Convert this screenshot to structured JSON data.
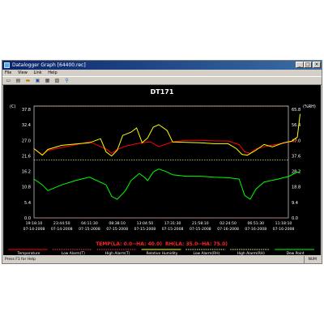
{
  "window": {
    "title": "Datalogger Graph [64400.rec]",
    "min": "_",
    "max": "□",
    "close": "×"
  },
  "menu": [
    "File",
    "View",
    "Link",
    "Help"
  ],
  "toolbar_icons": [
    "new-icon",
    "open-icon",
    "save-icon",
    "print-icon",
    "zoom-icon"
  ],
  "graph": {
    "title": "DT171",
    "left_unit": "(C)",
    "right_unit": "(%RH)",
    "left_ticks": [
      "37.8",
      "32.4",
      "27.0",
      "21.6",
      "16.2",
      "10.8",
      "5.4",
      "0.0"
    ],
    "right_ticks": [
      "65.8",
      "56.4",
      "47.0",
      "37.6",
      "28.2",
      "18.8",
      "9.4",
      "0.0"
    ],
    "x_times": [
      "19:18:10",
      "23:44:50",
      "04:11:30",
      "08:38:10",
      "13:04:50",
      "17:31:30",
      "21:58:10",
      "02:24:50",
      "06:51:30",
      "11:18:10"
    ],
    "x_dates": [
      "07-14-2008",
      "07-14-2008",
      "07-15-2008",
      "07-15-2008",
      "07-15-2008",
      "07-15-2008",
      "07-15-2008",
      "07-16-2008",
      "07-16-2008",
      "07-16-2008"
    ],
    "alarm_text_temp": "TEMP(LA: 0.0--HA: 40.0)",
    "alarm_text_rh": "RH(LA: 35.0--HA: 75.0)",
    "legend": [
      {
        "label": "Temperature",
        "color": "#ff0000",
        "dashed": false
      },
      {
        "label": "Low Alarm(T)",
        "color": "#ff4040",
        "dashed": true
      },
      {
        "label": "High Alarm(T)",
        "color": "#ff4040",
        "dashed": true
      },
      {
        "label": "Relative Humidity",
        "color": "#ffff00",
        "dashed": false
      },
      {
        "label": "Low Alarm(RH)",
        "color": "#ffff80",
        "dashed": true
      },
      {
        "label": "High Alarm(RH)",
        "color": "#ffff80",
        "dashed": true
      },
      {
        "label": "Dew Point",
        "color": "#00ff00",
        "dashed": false
      }
    ]
  },
  "status": {
    "left": "Press F1 for Help",
    "right": "NUM"
  },
  "chart_data": {
    "type": "line",
    "title": "DT171",
    "ylabel": "(C)",
    "y2label": "(%RH)",
    "ylim": [
      0,
      37.8
    ],
    "y2lim": [
      0,
      65.8
    ],
    "categories": [
      "19:18:10",
      "23:44:50",
      "04:11:30",
      "08:38:10",
      "13:04:50",
      "17:31:30",
      "21:58:10",
      "02:24:50",
      "06:51:30",
      "11:18:10"
    ],
    "series": [
      {
        "name": "Temperature",
        "axis": "left",
        "color": "#ff0000",
        "x": [
          0,
          0.3,
          0.5,
          1.0,
          2.0,
          2.6,
          2.8,
          3.0,
          3.3,
          3.8,
          4.2,
          4.5,
          5.0,
          5.5,
          6.0,
          6.6,
          7.0,
          7.4,
          7.6,
          7.8,
          8.0,
          8.5,
          9.0,
          9.5
        ],
        "values": [
          24.0,
          22.0,
          23.5,
          24.5,
          26.5,
          24.0,
          22.5,
          23.8,
          25.0,
          26.0,
          26.5,
          24.8,
          26.5,
          27.0,
          27.0,
          26.8,
          26.8,
          25.5,
          23.0,
          22.5,
          24.0,
          25.2,
          26.0,
          27.0
        ]
      },
      {
        "name": "Relative Humidity",
        "axis": "right",
        "color": "#ffff00",
        "x": [
          0,
          0.3,
          0.5,
          1.0,
          2.0,
          2.4,
          2.6,
          2.8,
          3.0,
          3.2,
          3.5,
          3.7,
          3.9,
          4.1,
          4.3,
          4.5,
          4.8,
          5.0,
          5.5,
          6.0,
          6.5,
          7.0,
          7.3,
          7.5,
          7.7,
          8.0,
          8.3,
          8.6,
          9.0,
          9.3,
          9.5,
          9.6
        ],
        "values": [
          42.0,
          38.0,
          41.5,
          44.0,
          45.5,
          48.0,
          40.0,
          37.5,
          41.0,
          50.0,
          52.0,
          54.5,
          45.5,
          48.5,
          55.0,
          56.5,
          53.0,
          46.0,
          45.8,
          45.5,
          45.0,
          45.0,
          42.0,
          38.5,
          38.0,
          41.0,
          44.5,
          43.0,
          45.5,
          46.5,
          49.0,
          63.0
        ]
      },
      {
        "name": "Dew Point",
        "axis": "left",
        "color": "#00ff00",
        "x": [
          0,
          0.3,
          0.5,
          1.0,
          1.5,
          2.0,
          2.6,
          2.8,
          3.0,
          3.3,
          3.5,
          3.8,
          4.0,
          4.1,
          4.3,
          4.5,
          4.8,
          5.0,
          5.5,
          6.0,
          6.5,
          7.0,
          7.4,
          7.6,
          7.8,
          8.0,
          8.3,
          8.8,
          9.2,
          9.5,
          9.6
        ],
        "values": [
          13.5,
          11.5,
          9.5,
          11.5,
          13.0,
          14.2,
          11.5,
          7.5,
          6.5,
          9.5,
          13.0,
          15.5,
          14.0,
          13.0,
          16.0,
          17.0,
          16.0,
          15.0,
          14.5,
          14.5,
          14.2,
          14.0,
          13.5,
          7.8,
          6.5,
          10.0,
          12.5,
          13.5,
          14.5,
          16.0,
          15.8
        ]
      }
    ],
    "alarm_lines": [
      {
        "name": "High Alarm(T)",
        "axis": "left",
        "value": 40.0
      },
      {
        "name": "Low Alarm(T)",
        "axis": "left",
        "value": 0.0
      },
      {
        "name": "High Alarm(RH)",
        "axis": "right",
        "value": 75.0
      },
      {
        "name": "Low Alarm(RH)",
        "axis": "right",
        "value": 35.0
      }
    ],
    "grid": false,
    "legend": "bottom"
  }
}
